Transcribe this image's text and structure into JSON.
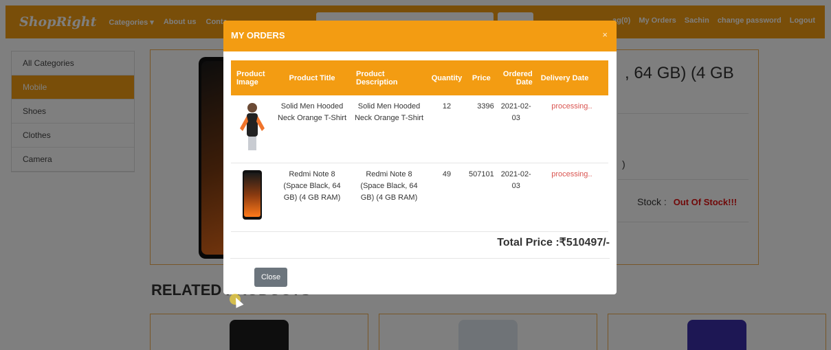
{
  "navbar": {
    "brand": "ShopRight",
    "links": [
      "Categories ▾",
      "About us",
      "Conta"
    ],
    "right_links": [
      "ag(0)",
      "My Orders",
      "Sachin",
      "change password",
      "Logout"
    ]
  },
  "sidebar": {
    "items": [
      {
        "label": "All Categories",
        "active": false
      },
      {
        "label": "Mobile",
        "active": true
      },
      {
        "label": "Shoes",
        "active": false
      },
      {
        "label": "Clothes",
        "active": false
      },
      {
        "label": "Camera",
        "active": false
      }
    ]
  },
  "product": {
    "title_fragment": ", 64 GB) (4 GB",
    "paren_fragment": ")",
    "stock_label": "Stock :",
    "stock_value": "Out Of Stock!!!"
  },
  "related": {
    "heading": "RELATED PRODUCTS"
  },
  "modal": {
    "title": "MY ORDERS",
    "close_icon": "×",
    "headers": {
      "image": "Product Image",
      "title": "Product Title",
      "description": "Product Description",
      "quantity": "Quantity",
      "price": "Price",
      "ordered_date": "Ordered Date",
      "delivery_date": "Delivery Date"
    },
    "orders": [
      {
        "image_icon": "hoodie-model-image",
        "title": "Solid Men Hooded Neck Orange T-Shirt",
        "description": "Solid Men Hooded Neck Orange T-Shirt",
        "quantity": "12",
        "price": "3396",
        "ordered_date": "2021-02-03",
        "delivery_date": "processing.."
      },
      {
        "image_icon": "smartphone-image",
        "title": "Redmi Note 8 (Space Black, 64 GB) (4 GB RAM)",
        "description": "Redmi Note 8 (Space Black, 64 GB) (4 GB RAM)",
        "quantity": "49",
        "price": "507101",
        "ordered_date": "2021-02-03",
        "delivery_date": "processing.."
      }
    ],
    "total": "Total Price :₹510497/-",
    "close_button": "Close"
  },
  "colors": {
    "accent": "#f39c12",
    "status": "#d9534f",
    "out_of_stock": "#e01010"
  }
}
